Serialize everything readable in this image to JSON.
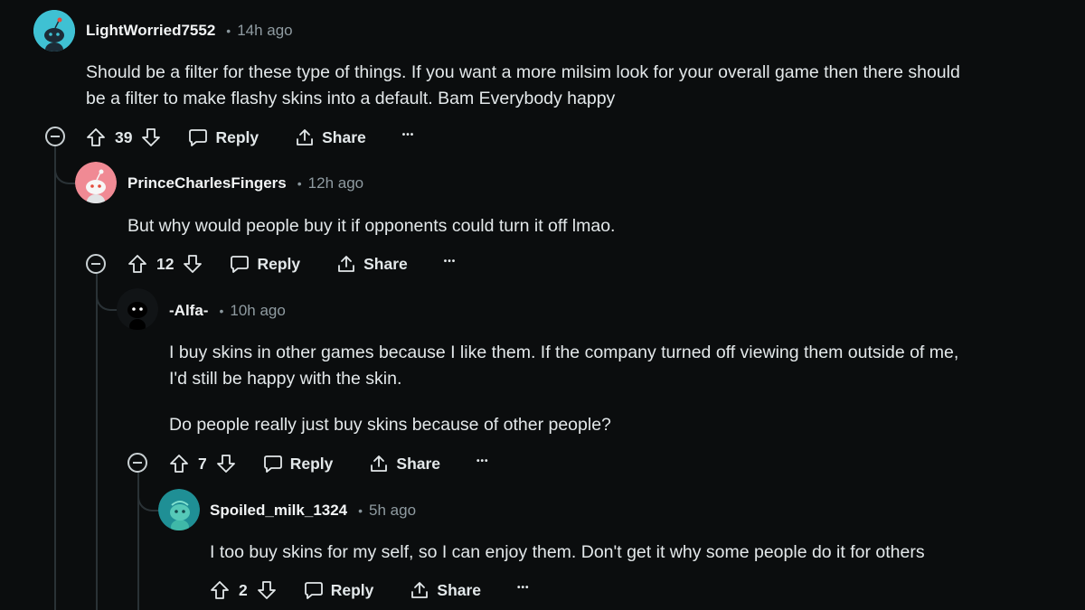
{
  "comments": [
    {
      "username": "LightWorried7552",
      "time": "14h ago",
      "lines": [
        "Should be a filter for these type of things. If you want a more milsim look for your overall game then there should",
        "be a filter to make flashy skins into a default. Bam Everybody happy"
      ],
      "votes": "39",
      "reply_label": "Reply",
      "share_label": "Share",
      "more_label": "•••",
      "avatar_color": "#3fc1d3"
    },
    {
      "username": "PrinceCharlesFingers",
      "time": "12h ago",
      "lines": [
        "But why would people buy it if opponents could turn it off lmao."
      ],
      "votes": "12",
      "reply_label": "Reply",
      "share_label": "Share",
      "more_label": "•••",
      "avatar_color": "#f08a94"
    },
    {
      "username": "-Alfa-",
      "time": "10h ago",
      "lines": [
        "I buy skins in other games because I like them. If the company turned off viewing them outside of me,",
        "I'd still be happy with the skin."
      ],
      "paragraph2": "Do people really just buy skins because of other people?",
      "votes": "7",
      "reply_label": "Reply",
      "share_label": "Share",
      "more_label": "•••",
      "avatar_color": "#000000"
    },
    {
      "username": "Spoiled_milk_1324",
      "time": "5h ago",
      "lines": [
        "I too buy skins for my self, so I can enjoy them. Don't get it why some people do it for others"
      ],
      "votes": "2",
      "reply_label": "Reply",
      "share_label": "Share",
      "more_label": "•••",
      "avatar_color": "#1f8f95"
    }
  ],
  "separator": "•"
}
